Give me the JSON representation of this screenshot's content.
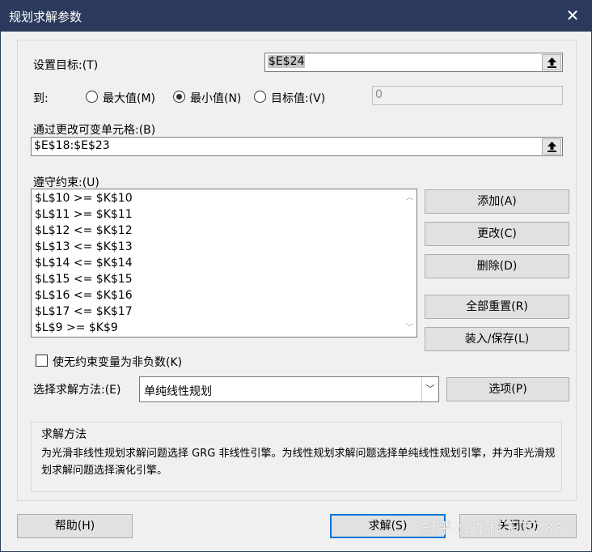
{
  "window": {
    "title": "规划求解参数",
    "close_glyph": "✕"
  },
  "objective": {
    "label": "设置目标:(T)",
    "value": "$E$24"
  },
  "to": {
    "label": "到:",
    "options": [
      {
        "label": "最大值(M)",
        "selected": false
      },
      {
        "label": "最小值(N)",
        "selected": true
      },
      {
        "label": "目标值:(V)",
        "selected": false
      }
    ],
    "target_value": "0"
  },
  "variables": {
    "label": "通过更改可变单元格:(B)",
    "value": "$E$18:$E$23"
  },
  "constraints": {
    "label": "遵守约束:(U)",
    "items": [
      "$L$10 >= $K$10",
      "$L$11 >= $K$11",
      "$L$12 <= $K$12",
      "$L$13 <= $K$13",
      "$L$14 <= $K$14",
      "$L$15 <= $K$15",
      "$L$16 <= $K$16",
      "$L$17 <= $K$17",
      "$L$9 >= $K$9"
    ]
  },
  "constraint_buttons": {
    "add": "添加(A)",
    "change": "更改(C)",
    "delete": "删除(D)",
    "reset_all": "全部重置(R)",
    "load_save": "装入/保存(L)"
  },
  "nonneg": {
    "label": "使无约束变量为非负数(K)",
    "checked": false
  },
  "method": {
    "label": "选择求解方法:(E)",
    "value": "单纯线性规划",
    "options_button": "选项(P)"
  },
  "method_group": {
    "title": "求解方法",
    "description": "为光滑非线性规划求解问题选择 GRG 非线性引擎。为线性规划求解问题选择单纯线性规划引擎，并为非光滑规划求解问题选择演化引擎。"
  },
  "footer": {
    "help": "帮助(H)",
    "solve": "求解(S)",
    "close": "关闭(O)"
  },
  "watermark": "知乎 @龙科天下288"
}
